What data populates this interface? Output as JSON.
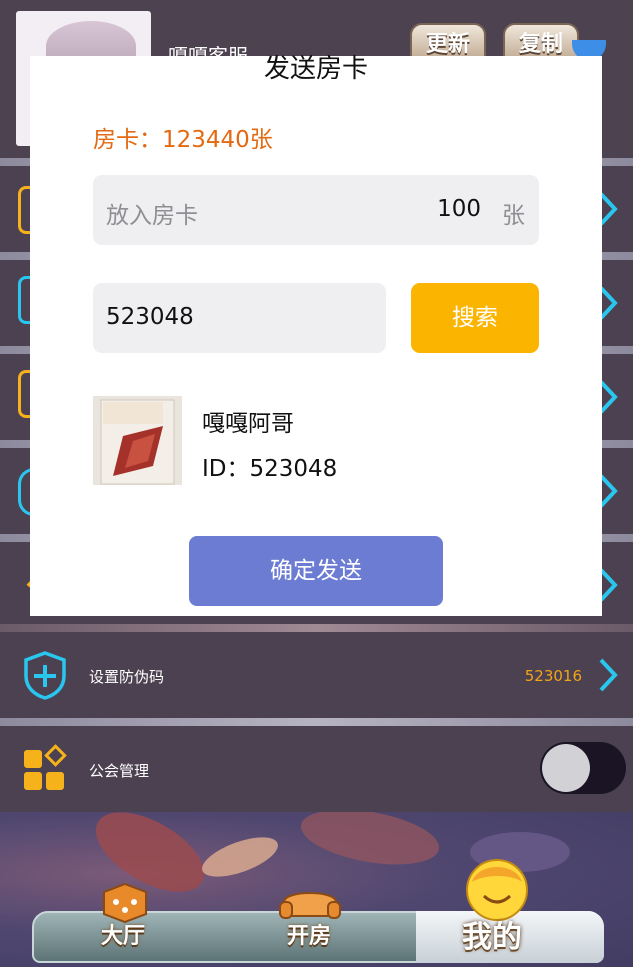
{
  "header": {
    "name": "嘎嘎客服",
    "refresh_label": "更新",
    "copy_label": "复制"
  },
  "menu": {
    "anti_fake": {
      "label": "设置防伪码",
      "value": "523016"
    },
    "guild": {
      "label": "公会管理",
      "toggle_on": false
    }
  },
  "dialog": {
    "title": "发送房卡",
    "balance": "房卡：123440张",
    "card_input": {
      "placeholder": "放入房卡",
      "value": "100",
      "unit": "张"
    },
    "id_input": {
      "value": "523048"
    },
    "search_label": "搜索",
    "result": {
      "name": "嘎嘎阿哥",
      "id_text": "ID：523048"
    },
    "confirm_label": "确定发送"
  },
  "nav": {
    "hall": "大厅",
    "room": "开房",
    "mine": "我的"
  },
  "colors": {
    "accent_orange": "#e36a12",
    "search_yellow": "#fbb400",
    "confirm_blue": "#6c7cd3",
    "value_orange": "#f2a516",
    "chevron_cyan": "#29c7f0"
  }
}
